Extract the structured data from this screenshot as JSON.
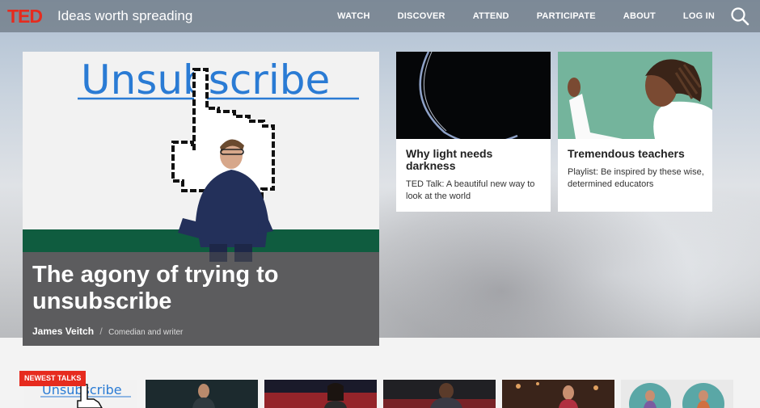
{
  "header": {
    "logo": "TED",
    "tagline": "Ideas worth spreading",
    "nav": [
      "WATCH",
      "DISCOVER",
      "ATTEND",
      "PARTICIPATE",
      "ABOUT",
      "LOG IN"
    ],
    "search_icon": "search-icon"
  },
  "feature": {
    "image_text": "Unsubscribe",
    "title": "The agony of trying to unsubscribe",
    "speaker": "James Veitch",
    "separator": "/",
    "role": "Comedian and writer"
  },
  "cards": [
    {
      "title": "Why light needs darkness",
      "description": "TED Talk: A beautiful new way to look at the world"
    },
    {
      "title": "Tremendous teachers",
      "description": "Playlist: Be inspired by these wise, determined educators"
    }
  ],
  "newest": {
    "badge": "NEWEST TALKS",
    "first_thumb_text": "Unsubscribe"
  },
  "colors": {
    "brand_red": "#e62b1e",
    "link_blue": "#1a73c8"
  }
}
